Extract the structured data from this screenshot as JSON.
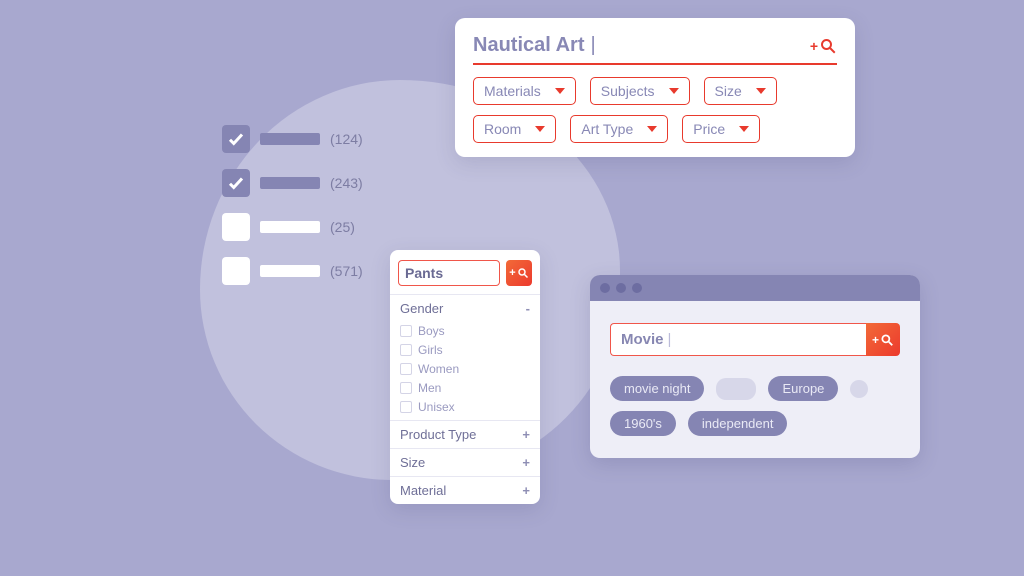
{
  "colors": {
    "accent_red": "#e83a2d",
    "purple": "#8585b3",
    "text_muted": "#8888b5"
  },
  "checklist": {
    "items": [
      {
        "checked": true,
        "count": "(124)"
      },
      {
        "checked": true,
        "count": "(243)"
      },
      {
        "checked": false,
        "count": "(25)"
      },
      {
        "checked": false,
        "count": "(571)"
      }
    ]
  },
  "nautical": {
    "search_value": "Nautical Art",
    "filters": [
      "Materials",
      "Subjects",
      "Size",
      "Room",
      "Art Type",
      "Price"
    ]
  },
  "pants": {
    "search_value": "Pants",
    "sections": {
      "gender_label": "Gender",
      "gender_toggle": "-",
      "gender_options": [
        "Boys",
        "Girls",
        "Women",
        "Men",
        "Unisex"
      ],
      "product_type_label": "Product Type",
      "product_type_toggle": "+",
      "size_label": "Size",
      "size_toggle": "+",
      "material_label": "Material",
      "material_toggle": "+"
    }
  },
  "movie": {
    "search_value": "Movie",
    "tags": {
      "movie_night": "movie night",
      "europe": "Europe",
      "sixties": "1960's",
      "independent": "independent"
    }
  }
}
